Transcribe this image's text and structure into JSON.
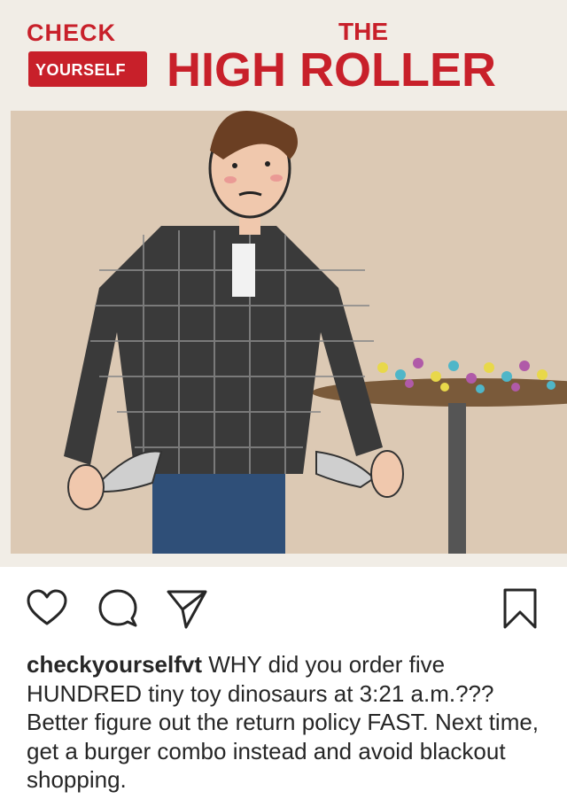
{
  "post": {
    "image": {
      "brand_top": "CHECK",
      "brand_bottom": "YOURSELF",
      "headline_small": "THE",
      "headline_large": "HIGH ROLLER",
      "brand_color": "#c8202a",
      "illustration": "cartoon man with empty pockets beside a table of toy dinosaurs"
    },
    "actions": {
      "like_icon": "heart-icon",
      "comment_icon": "comment-bubble-icon",
      "share_icon": "paper-plane-icon",
      "save_icon": "bookmark-icon"
    },
    "caption": {
      "username": "checkyourselfvt",
      "text": "WHY did you order five HUNDRED tiny toy dinosaurs at 3:21 a.m.??? Better figure out the return policy FAST. Next time, get a burger combo instead and avoid blackout shopping."
    }
  }
}
